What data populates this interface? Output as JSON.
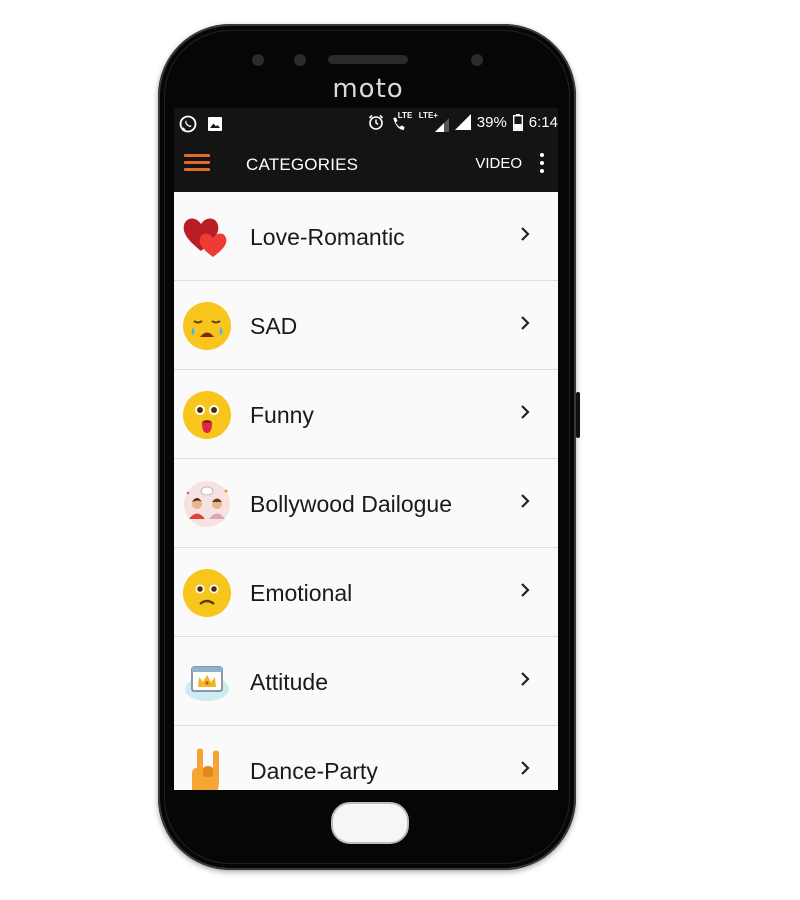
{
  "device": {
    "brand": "moto"
  },
  "status_bar": {
    "lte": "LTE",
    "lte_plus": "LTE+",
    "battery": "39%",
    "time": "6:14"
  },
  "app_bar": {
    "title": "CATEGORIES",
    "video_label": "VIDEO"
  },
  "categories": [
    {
      "label": "Love-Romantic",
      "icon": "hearts-icon"
    },
    {
      "label": "SAD",
      "icon": "crying-face-icon"
    },
    {
      "label": "Funny",
      "icon": "tongue-out-face-icon"
    },
    {
      "label": "Bollywood Dailogue",
      "icon": "couple-chat-icon"
    },
    {
      "label": "Emotional",
      "icon": "frowning-face-icon"
    },
    {
      "label": "Attitude",
      "icon": "crown-window-icon"
    },
    {
      "label": "Dance-Party",
      "icon": "rock-hand-icon"
    }
  ],
  "colors": {
    "accent": "#e06a2a",
    "bar": "#141414",
    "list_bg": "#fafafa",
    "emoji": "#f8c51c"
  }
}
